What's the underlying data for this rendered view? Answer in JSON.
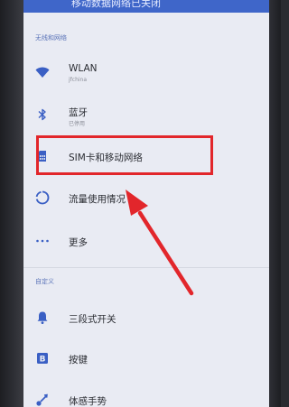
{
  "header": {
    "partial_text": "移动数据网络已关闭"
  },
  "sections": {
    "wireless": "无线和网络",
    "custom": "自定义"
  },
  "items": {
    "wlan": {
      "title": "WLAN",
      "subtitle": "jfchina",
      "icon": "wifi-icon"
    },
    "bluetooth": {
      "title": "蓝牙",
      "subtitle": "已停用",
      "icon": "bluetooth-icon"
    },
    "sim": {
      "title": "SIM卡和移动网络",
      "icon": "sim-card-icon"
    },
    "data_usage": {
      "title": "流量使用情况",
      "icon": "data-usage-icon"
    },
    "more": {
      "title": "更多",
      "icon": "more-icon"
    },
    "three_stage": {
      "title": "三段式开关",
      "icon": "alert-slider-icon"
    },
    "buttons": {
      "title": "按键",
      "icon": "buttons-icon"
    },
    "gestures": {
      "title": "体感手势",
      "icon": "gestures-icon"
    }
  },
  "colors": {
    "accent": "#3f66c9",
    "icon_blue": "#3a5fc4",
    "annotation_red": "#e2262b",
    "screen_bg": "#e9ebf3"
  }
}
